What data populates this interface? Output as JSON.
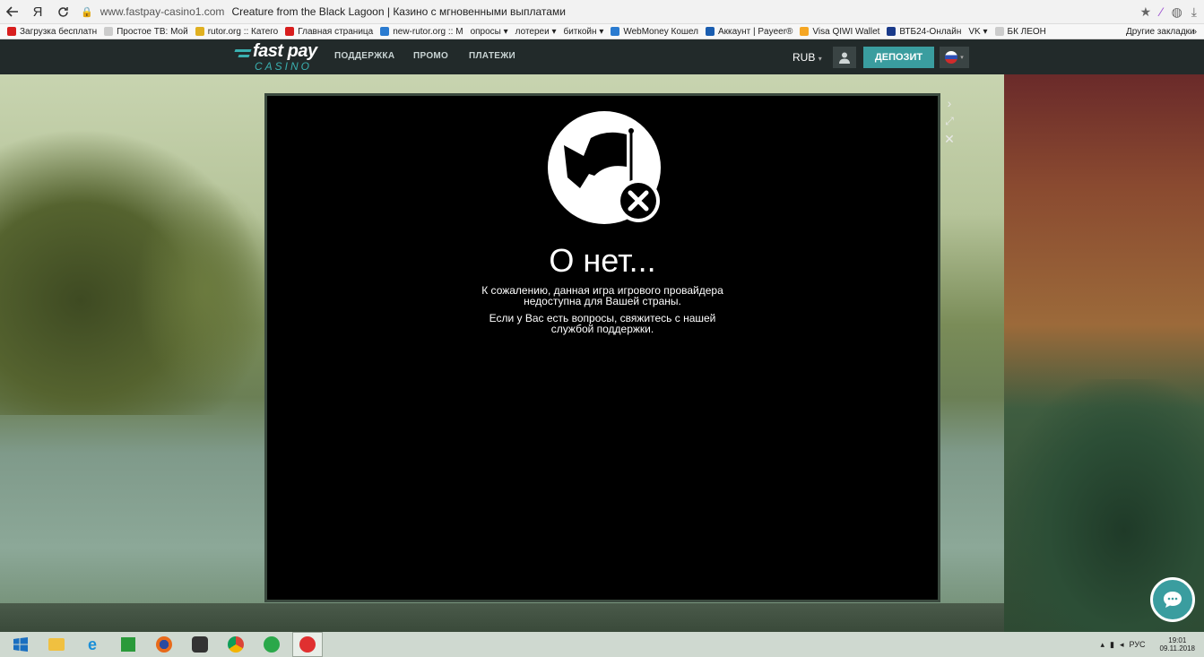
{
  "browser": {
    "host": "www.fastpay-casino1.com",
    "title": "Creature from the Black Lagoon | Казино с мгновенными выплатами",
    "back_icon": "arrow-left-icon",
    "yandex_glyph": "Я",
    "reload_icon": "reload-icon",
    "bookmarks": [
      {
        "label": "Загрузка бесплатн",
        "color": "#d81e1e"
      },
      {
        "label": "Простое ТВ: Мой",
        "color": "#cccccc"
      },
      {
        "label": "rutor.org :: Катего",
        "color": "#e0b020"
      },
      {
        "label": "Главная страница",
        "color": "#d81e1e"
      },
      {
        "label": "new-rutor.org :: М",
        "color": "#2a7bd0"
      },
      {
        "label": "опросы ▾",
        "color": ""
      },
      {
        "label": "лотереи ▾",
        "color": ""
      },
      {
        "label": "биткойн ▾",
        "color": ""
      },
      {
        "label": "WebMoney Кошел",
        "color": "#2a7bd0"
      },
      {
        "label": "Аккаунт | Payeer®",
        "color": "#1a5db0"
      },
      {
        "label": "Visa QIWI Wallet",
        "color": "#f5a623"
      },
      {
        "label": "ВТБ24-Онлайн",
        "color": "#1a3a8a"
      },
      {
        "label": "VK ▾",
        "color": ""
      },
      {
        "label": "БК ЛЕОН",
        "color": "#cccccc"
      }
    ],
    "more_bookmarks": "»",
    "other_bookmarks": "Другие закладки"
  },
  "site": {
    "logo_fast": "fast pay",
    "logo_casino": "CASINO",
    "nav": [
      "ПОДДЕРЖКА",
      "ПРОМО",
      "ПЛАТЕЖИ"
    ],
    "currency": "RUB",
    "deposit": "ДЕПОЗИТ"
  },
  "game_error": {
    "title": "О нет...",
    "line1a": "К сожалению, данная игра игрового провайдера",
    "line1b": "недоступна для Вашей страны.",
    "line2a": "Если у Вас есть вопросы, свяжитесь с нашей",
    "line2b": "службой поддержки."
  },
  "taskbar": {
    "lang": "РУС",
    "time": "19:01",
    "date": "09.11.2018"
  },
  "colors": {
    "accent": "#3a9d9f",
    "header_bg": "#222a2a"
  }
}
